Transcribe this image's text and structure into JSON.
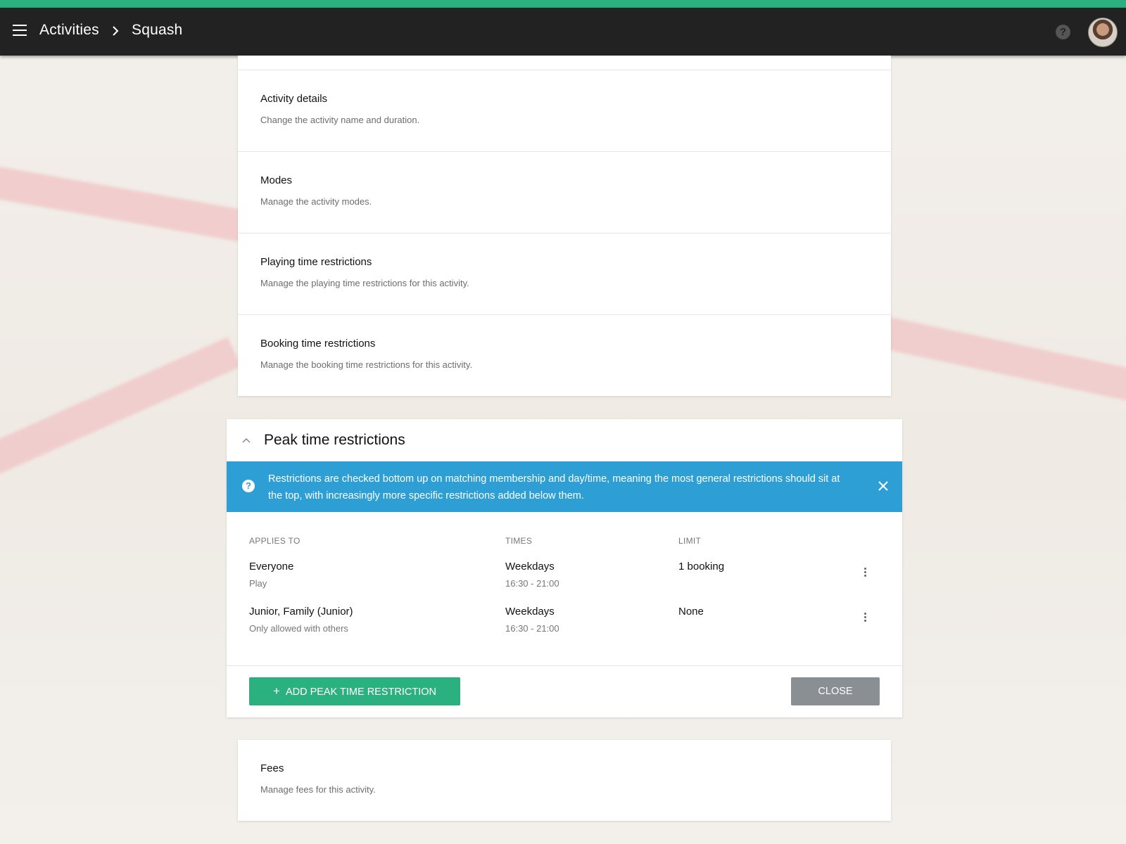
{
  "header": {
    "breadcrumb": [
      "Activities",
      "Squash"
    ],
    "accent_color": "#2bb07f"
  },
  "settings": [
    {
      "title": "Activity details",
      "description": "Change the activity name and duration."
    },
    {
      "title": "Modes",
      "description": "Manage the activity modes."
    },
    {
      "title": "Playing time restrictions",
      "description": "Manage the playing time restrictions for this activity."
    },
    {
      "title": "Booking time restrictions",
      "description": "Manage the booking time restrictions for this activity."
    }
  ],
  "peak": {
    "title": "Peak time restrictions",
    "info": "Restrictions are checked bottom up on matching membership and day/time, meaning the most general restrictions should sit at the top, with increasingly more specific restrictions added below them.",
    "columns": {
      "applies_to": "APPLIES TO",
      "times": "TIMES",
      "limit": "LIMIT"
    },
    "rows": [
      {
        "applies": "Everyone",
        "applies_sub": "Play",
        "days": "Weekdays",
        "hours": "16:30 - 21:00",
        "limit": "1 booking"
      },
      {
        "applies": "Junior, Family (Junior)",
        "applies_sub": "Only allowed with others",
        "days": "Weekdays",
        "hours": "16:30 - 21:00",
        "limit": "None"
      }
    ],
    "add_button": "ADD PEAK TIME RESTRICTION",
    "close_button": "CLOSE",
    "info_color": "#2e9fd4"
  },
  "fees": {
    "title": "Fees",
    "description": "Manage fees for this activity."
  }
}
